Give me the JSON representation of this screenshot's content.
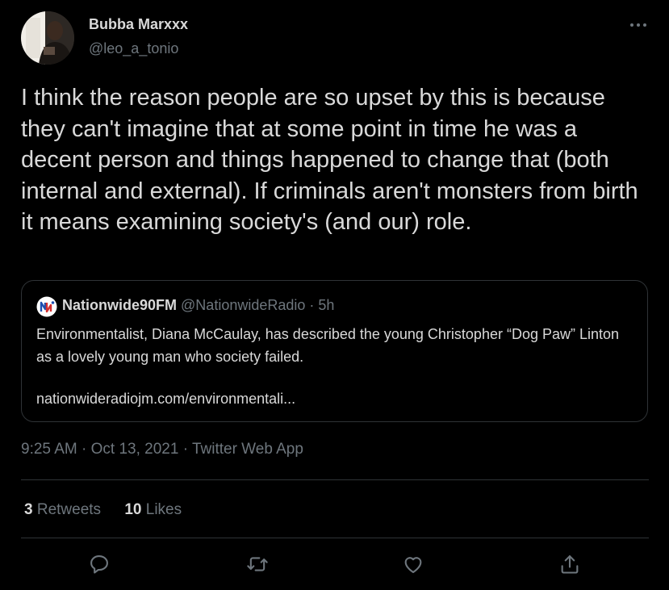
{
  "author": {
    "display_name": "Bubba Marxxx",
    "handle": "@leo_a_tonio"
  },
  "header": {
    "more_icon": "more-horizontal-icon"
  },
  "tweet": {
    "text": "I think the reason people are so upset by this is because they can't imagine that at some point in time he was a decent person and things happened to change that (both internal and external). If criminals aren't monsters from birth it means examining society's (and our) role."
  },
  "quote": {
    "logo_icon": "nationwide-logo-icon",
    "name": "Nationwide90FM",
    "handle": "@NationwideRadio",
    "separator": "·",
    "age": "5h",
    "text": "Environmentalist, Diana McCaulay, has described the young Christopher “Dog Paw” Linton as a lovely young man who society failed.",
    "link": "nationwideradiojm.com/environmentali..."
  },
  "meta": {
    "time": "9:25 AM",
    "sep1": "·",
    "date": "Oct 13, 2021",
    "sep2": "·",
    "source": "Twitter Web App"
  },
  "stats": {
    "retweets_count": "3",
    "retweets_label": "Retweets",
    "likes_count": "10",
    "likes_label": "Likes"
  },
  "actions": [
    {
      "icon": "reply-icon"
    },
    {
      "icon": "retweet-icon"
    },
    {
      "icon": "like-icon"
    },
    {
      "icon": "share-icon"
    }
  ],
  "colors": {
    "background": "#000000",
    "text": "#d9d9d9",
    "secondary": "#6e767d",
    "border": "#2f3336"
  }
}
